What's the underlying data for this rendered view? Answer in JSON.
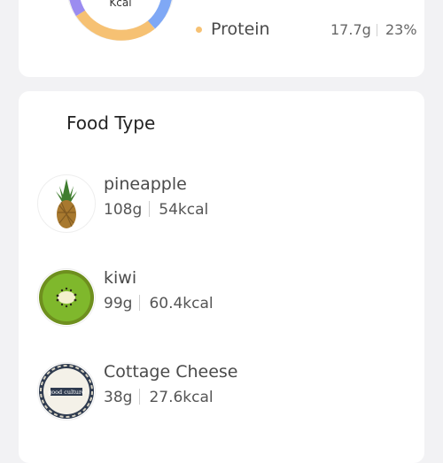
{
  "summary": {
    "donut_unit": "Kcal",
    "macros": [
      {
        "name": "Protein",
        "grams": "17.7g",
        "percent": "23%",
        "color": "#f6c173"
      }
    ],
    "ring_colors": [
      "#9b8cf0",
      "#f6c173",
      "#7fa8f5"
    ]
  },
  "foods_section": {
    "title": "Food Type",
    "items": [
      {
        "name": "pineapple",
        "weight": "108g",
        "kcal": "54kcal",
        "icon": "pineapple-icon"
      },
      {
        "name": "kiwi",
        "weight": "99g",
        "kcal": "60.4kcal",
        "icon": "kiwi-icon"
      },
      {
        "name": "Cottage Cheese",
        "weight": "38g",
        "kcal": "27.6kcal",
        "icon": "cottage-cheese-icon",
        "brand_text": "good culture"
      }
    ]
  }
}
